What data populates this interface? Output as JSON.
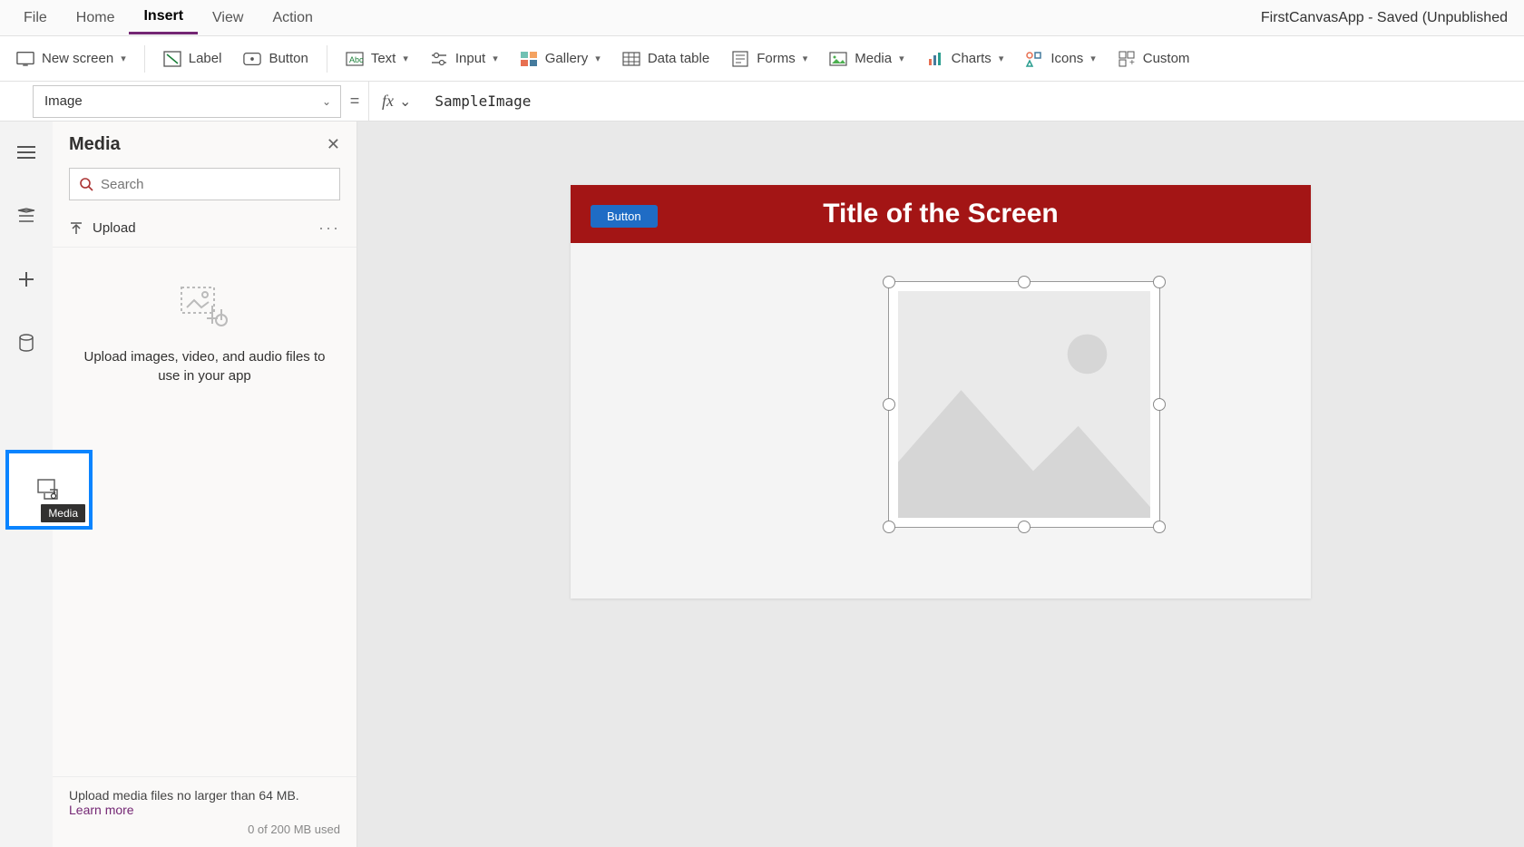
{
  "app_title": "FirstCanvasApp - Saved (Unpublished",
  "menu": {
    "file": "File",
    "home": "Home",
    "insert": "Insert",
    "view": "View",
    "action": "Action"
  },
  "ribbon": {
    "new_screen": "New screen",
    "label": "Label",
    "button": "Button",
    "text": "Text",
    "input": "Input",
    "gallery": "Gallery",
    "data_table": "Data table",
    "forms": "Forms",
    "media": "Media",
    "charts": "Charts",
    "icons": "Icons",
    "custom": "Custom"
  },
  "formula": {
    "property": "Image",
    "equals": "=",
    "fx": "fx",
    "value": "SampleImage"
  },
  "panel": {
    "title": "Media",
    "search_placeholder": "Search",
    "upload": "Upload",
    "empty_text": "Upload images, video, and audio files to use in your app",
    "footer_text": "Upload media files no larger than 64 MB.",
    "learn_more": "Learn more",
    "usage": "0 of 200 MB used"
  },
  "tooltip": {
    "media": "Media"
  },
  "canvas": {
    "screen_title": "Title of the Screen",
    "button_label": "Button"
  }
}
